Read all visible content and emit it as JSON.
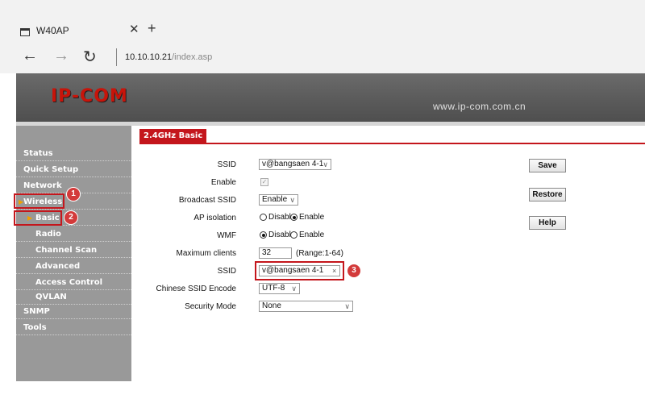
{
  "browser": {
    "tab_title": "W40AP",
    "url_host": "10.10.10.21",
    "url_path": "/index.asp",
    "back": "←",
    "forward": "→",
    "reload": "↻",
    "close": "✕",
    "new_tab": "+"
  },
  "header": {
    "logo": "IP-COM",
    "site": "www.ip-com.com.cn"
  },
  "sidebar": {
    "items": [
      {
        "label": "Status"
      },
      {
        "label": "Quick Setup"
      },
      {
        "label": "Network"
      },
      {
        "label": "Wireless"
      },
      {
        "label": "Basic"
      },
      {
        "label": "Radio"
      },
      {
        "label": "Channel Scan"
      },
      {
        "label": "Advanced"
      },
      {
        "label": "Access Control"
      },
      {
        "label": "QVLAN"
      },
      {
        "label": "SNMP"
      },
      {
        "label": "Tools"
      }
    ]
  },
  "badges": [
    "1",
    "2",
    "3"
  ],
  "page": {
    "section_title": "2.4GHz Basic",
    "fields": {
      "ssid_select_label": "SSID",
      "ssid_select_value": "v@bangsaen 4-1",
      "enable_label": "Enable",
      "enable_checked": "✓",
      "broadcast_label": "Broadcast SSID",
      "broadcast_value": "Enable",
      "ap_isolation_label": "AP isolation",
      "ap_isolation_options": [
        "Disable",
        "Enable"
      ],
      "wmf_label": "WMF",
      "wmf_options": [
        "Disable",
        "Enable"
      ],
      "max_clients_label": "Maximum clients",
      "max_clients_value": "32",
      "max_clients_range": "(Range:1-64)",
      "ssid_input_label": "SSID",
      "ssid_input_value": "v@bangsaen 4-1",
      "clear_icon": "×",
      "chinese_label": "Chinese SSID Encode",
      "chinese_value": "UTF-8",
      "security_label": "Security Mode",
      "security_value": "None"
    },
    "buttons": {
      "save": "Save",
      "restore": "Restore",
      "help": "Help"
    }
  },
  "colors": {
    "accent": "#c4161c",
    "sidebar_bg": "#999999",
    "header_bg": "#5c5c5c"
  }
}
